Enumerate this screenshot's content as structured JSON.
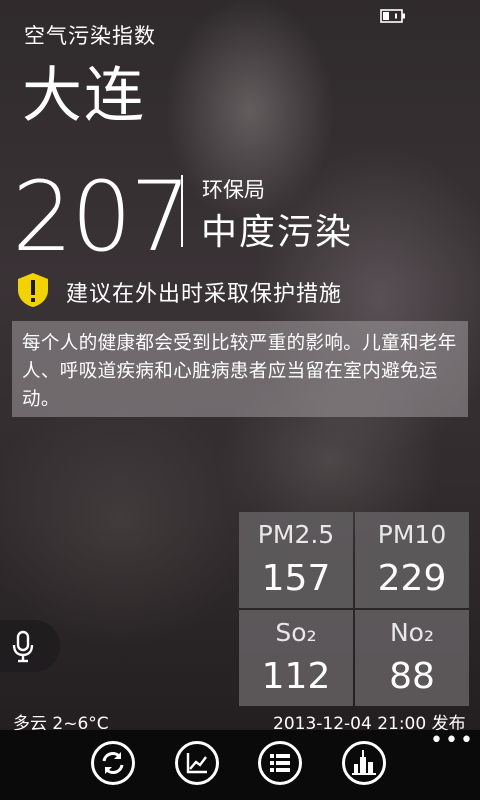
{
  "header": {
    "app_title": "空气污染指数",
    "city": "大连"
  },
  "aqi": {
    "value": "207",
    "source": "环保局",
    "level": "中度污染"
  },
  "advice": "建议在外出时采取保护措施",
  "health_note": "每个人的健康都会受到比较严重的影响。儿童和老年人、呼吸道疾病和心脏病患者应当留在室内避免运动。",
  "pollutants": [
    {
      "label": "PM2.5",
      "value": "157"
    },
    {
      "label": "PM10",
      "value": "229"
    },
    {
      "label": "So₂",
      "value": "112"
    },
    {
      "label": "No₂",
      "value": "88"
    }
  ],
  "footer": {
    "weather": "多云 2~6°C",
    "published": "2013-12-04 21:00 发布"
  },
  "appbar": {
    "more": "•••",
    "buttons": [
      "refresh-icon",
      "trend-chart-icon",
      "list-icon",
      "city-icon"
    ]
  },
  "colors": {
    "warning": "#f2d200",
    "cell_bg": "#605c5e"
  }
}
